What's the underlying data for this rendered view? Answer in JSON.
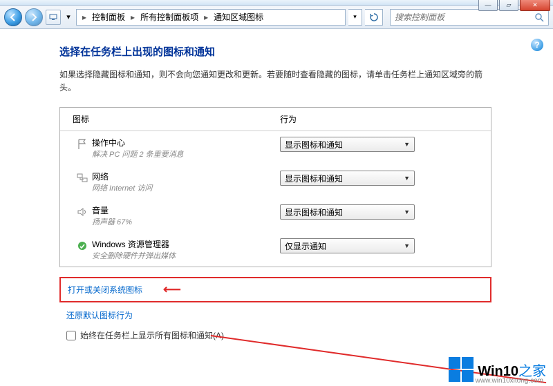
{
  "breadcrumb": {
    "seg1": "控制面板",
    "seg2": "所有控制面板项",
    "seg3": "通知区域图标"
  },
  "search": {
    "placeholder": "搜索控制面板"
  },
  "page": {
    "title": "选择在任务栏上出现的图标和通知",
    "intro": "如果选择隐藏图标和通知，则不会向您通知更改和更新。若要随时查看隐藏的图标，请单击任务栏上通知区域旁的箭头。"
  },
  "table": {
    "headers": {
      "icon": "图标",
      "behavior": "行为"
    },
    "options": {
      "showIconAndNotice": "显示图标和通知",
      "onlyNotice": "仅显示通知"
    },
    "rows": [
      {
        "title": "操作中心",
        "sub": "解决 PC 问题  2 条重要消息",
        "icon": "flag",
        "value": "showIconAndNotice"
      },
      {
        "title": "网络",
        "sub": "网络 Internet 访问",
        "icon": "network",
        "value": "showIconAndNotice"
      },
      {
        "title": "音量",
        "sub": "扬声器 67%",
        "icon": "volume",
        "value": "showIconAndNotice"
      },
      {
        "title": "Windows 资源管理器",
        "sub": "安全删除硬件并弹出媒体",
        "icon": "usb",
        "value": "onlyNotice"
      }
    ]
  },
  "links": {
    "toggleSystemIcons": "打开或关闭系统图标",
    "restoreDefault": "还原默认图标行为"
  },
  "checkbox": {
    "label": "始终在任务栏上显示所有图标和通知(A)"
  },
  "watermark": {
    "brand_a": "Win10",
    "brand_b": "之家",
    "url": "www.win10xitong.com"
  }
}
